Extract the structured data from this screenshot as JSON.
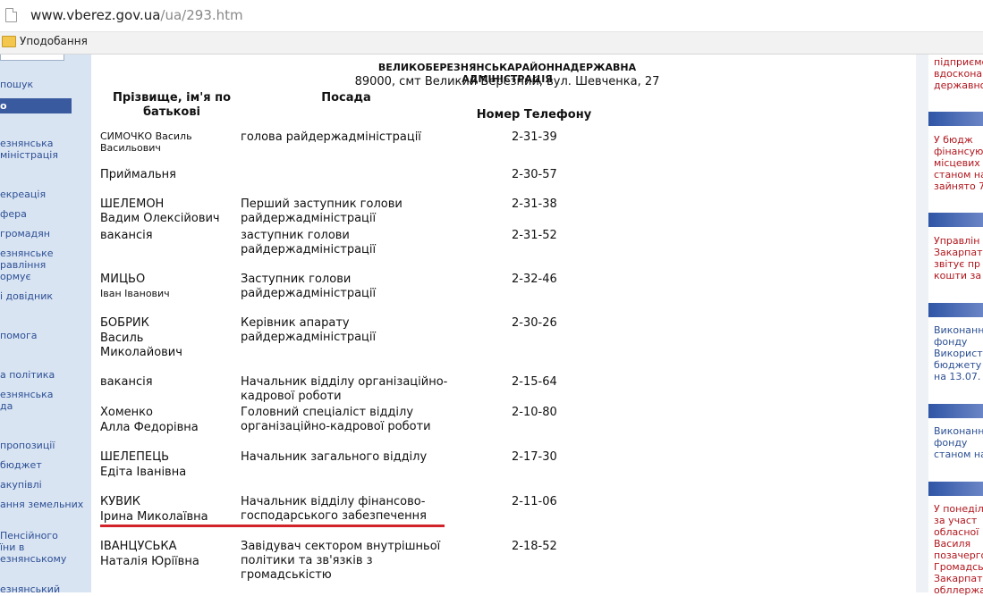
{
  "browser": {
    "url_main": "www.vberez.gov.ua",
    "url_path": "/ua/293.htm",
    "bookmark_label": "Уподобання"
  },
  "left_sidebar": {
    "items": [
      {
        "label": "пошук"
      },
      {
        "label": "о"
      },
      {
        "label": "езнянська\nміністрація"
      },
      {
        "label": "екреація"
      },
      {
        "label": "фера"
      },
      {
        "label": "громадян"
      },
      {
        "label": "езнянське\nравління\nормує"
      },
      {
        "label": "і довідник"
      },
      {
        "label": "помога"
      },
      {
        "label": "а політика"
      },
      {
        "label": "езнянська\nда"
      },
      {
        "label": "пропозиції"
      },
      {
        "label": "бюджет"
      },
      {
        "label": "акупівлі"
      },
      {
        "label": "ання земельних"
      },
      {
        "label": "Пенсійного\nїни в\nезнянському"
      },
      {
        "label": "езнянський"
      }
    ]
  },
  "page": {
    "title": "ВЕЛИКОБЕРЕЗНЯНСЬКАРАЙОННАДЕРЖАВНА АДМІНІСТРАЦІЯ",
    "address": "89000, смт Великий Березний, вул. Шевченка, 27",
    "col_name": "Прізвище, ім'я по\nбатькові",
    "col_position": "Посада",
    "col_phone": "Номер Телефону"
  },
  "rows": [
    {
      "name1": "СИМОЧКО Василь",
      "name2": "Васильович",
      "pos1": "голова райдержадміністрації",
      "pos2": "",
      "pos3": "",
      "phone": "2-31-39"
    },
    {
      "name1": "Приймальня",
      "name2": "",
      "pos1": "",
      "pos2": "",
      "pos3": "",
      "phone": "2-30-57"
    },
    {
      "name1": "ШЕЛЕМОН",
      "name2": "Вадим Олексійович",
      "pos1": "Перший заступник голови",
      "pos2": "райдержадміністрації",
      "pos3": "",
      "phone": "2-31-38"
    },
    {
      "name1": "вакансія",
      "name2": "",
      "pos1": "заступник голови",
      "pos2": "райдержадміністрації",
      "pos3": "",
      "phone": "2-31-52"
    },
    {
      "name1": "МИЦЬО",
      "name2": "Іван Іванович",
      "pos1": "Заступник голови",
      "pos2": "райдержадміністрації",
      "pos3": "",
      "phone": "2-32-46"
    },
    {
      "name1": "БОБРИК",
      "name2": "Василь",
      "name3": "Миколайович",
      "pos1": "Керівник апарату",
      "pos2": "райдержадміністрації",
      "pos3": "",
      "phone": "2-30-26"
    },
    {
      "name1": "вакансія",
      "name2": "",
      "pos1": "Начальник відділу організаційно-",
      "pos2": "кадрової роботи",
      "pos3": "",
      "phone": "2-15-64"
    },
    {
      "name1": "Хоменко",
      "name2": "Алла Федорівна",
      "pos1": "Головний спеціаліст відділу",
      "pos2": "організаційно-кадрової роботи",
      "pos3": "",
      "phone": "2-10-80"
    },
    {
      "name1": "ШЕЛЕПЕЦЬ",
      "name2": "Едіта Іванівна",
      "pos1": "Начальник загального відділу",
      "pos2": "",
      "pos3": "",
      "phone": "2-17-30"
    },
    {
      "name1": "КУВИК",
      "name2": "Ірина Миколаївна",
      "pos1": "Начальник відділу фінансово-",
      "pos2": "господарського забезпечення",
      "pos3": "",
      "phone": "2-11-06"
    },
    {
      "name1": "ІВАНЦУСЬКА",
      "name2": "Наталія Юріївна",
      "pos1": "Завідувач сектором внутрішньої",
      "pos2": "політики та зв'язків з",
      "pos3": "громадськістю",
      "phone": "2-18-52"
    }
  ],
  "right_sidebar": {
    "blocks": [
      {
        "lines": [
          "підприємс",
          "вдоскона",
          "державно"
        ],
        "color": "red"
      },
      {
        "lines": [
          "У бюдж",
          "фінансую",
          "місцевих",
          "станом на",
          "зайнято 7"
        ],
        "color": "red"
      },
      {
        "lines": [
          "Управлін",
          "Закарпат",
          "звітує пр",
          "кошти за"
        ],
        "color": "red"
      },
      {
        "lines": [
          "Виконанн",
          "фонду",
          "Використ",
          "бюджету",
          "на 13.07."
        ],
        "color": "blue"
      },
      {
        "lines": [
          "Виконанн",
          "фонду",
          "станом на"
        ],
        "color": "blue"
      },
      {
        "lines": [
          "У понеділ",
          "за участ",
          "обласної",
          "Василя",
          "позачерго",
          "Громадсь",
          "Закарпат",
          "обллержа"
        ],
        "color": "red"
      }
    ]
  },
  "colors": {
    "accent": "#3a5aa0",
    "highlight_underline": "#d2232a",
    "link": "#2c4f93",
    "news_red": "#b0161d"
  }
}
